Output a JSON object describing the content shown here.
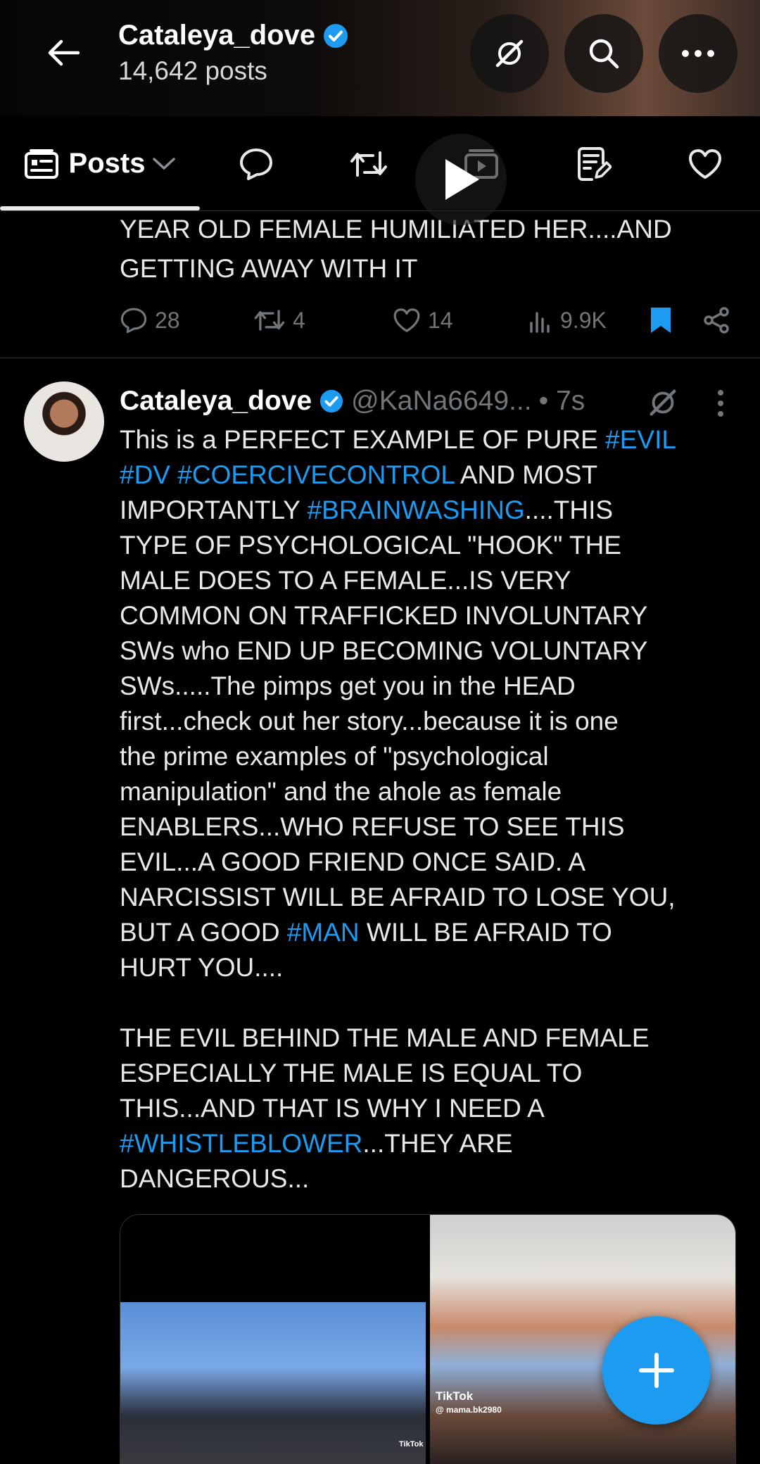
{
  "header": {
    "name": "Cataleya_dove",
    "posts_count": "14,642 posts"
  },
  "tabs": {
    "posts_label": "Posts"
  },
  "prev_tweet": {
    "text_line1": "YEAR OLD FEMALE  HUMILIATED HER....AND",
    "text_line2": "GETTING AWAY WITH IT",
    "replies": "28",
    "reposts": "4",
    "likes": "14",
    "views": "9.9K"
  },
  "tweet": {
    "name": "Cataleya_dove",
    "handle": "@KaNa6649...",
    "dot_time": "• 7s",
    "body": {
      "l1a": "This is a PERFECT EXAMPLE OF PURE ",
      "l1tag": "#EVIL",
      "l2tag1": "#DV",
      "l2tag2": "#COERCIVECONTROL",
      "l2b": " AND MOST",
      "l3a": "IMPORTANTLY ",
      "l3tag": "#BRAINWASHING",
      "l3b": "....THIS",
      "l4": "TYPE OF PSYCHOLOGICAL \"HOOK\" THE",
      "l5": "MALE DOES TO A FEMALE...IS VERY",
      "l6": "COMMON ON TRAFFICKED INVOLUNTARY",
      "l7": "SWs who END UP BECOMING VOLUNTARY",
      "l8": "SWs.....The pimps get you in the HEAD",
      "l9": "first...check out her story...because it is one",
      "l10": "the prime examples of \"psychological",
      "l11": "manipulation\" and the ahole as female",
      "l12": "ENABLERS...WHO REFUSE TO SEE THIS",
      "l13": "EVIL...A GOOD FRIEND ONCE SAID. A",
      "l14": "NARCISSIST WILL BE AFRAID TO LOSE YOU,",
      "l15a": "BUT A GOOD ",
      "l15tag": "#MAN",
      "l15b": " WILL BE AFRAID TO",
      "l16": "HURT YOU....",
      "l17": "THE EVIL BEHIND THE MALE AND FEMALE",
      "l18": "ESPECIALLY THE MALE IS EQUAL TO",
      "l19": "THIS...AND THAT IS WHY I NEED A",
      "l20tag": "#WHISTLEBLOWER",
      "l20b": "...THEY ARE",
      "l21": "DANGEROUS..."
    },
    "media": {
      "tiktok_label": "TikTok",
      "tiktok_user": "@ mama.bk2980",
      "tiktok_small": "TikTok"
    }
  },
  "colors": {
    "accent": "#1d9bf0",
    "muted": "#71767b",
    "background": "#000000"
  },
  "icons": {
    "back": "arrow-left-icon",
    "grok": "grok-icon",
    "search": "search-icon",
    "more": "more-icon"
  }
}
